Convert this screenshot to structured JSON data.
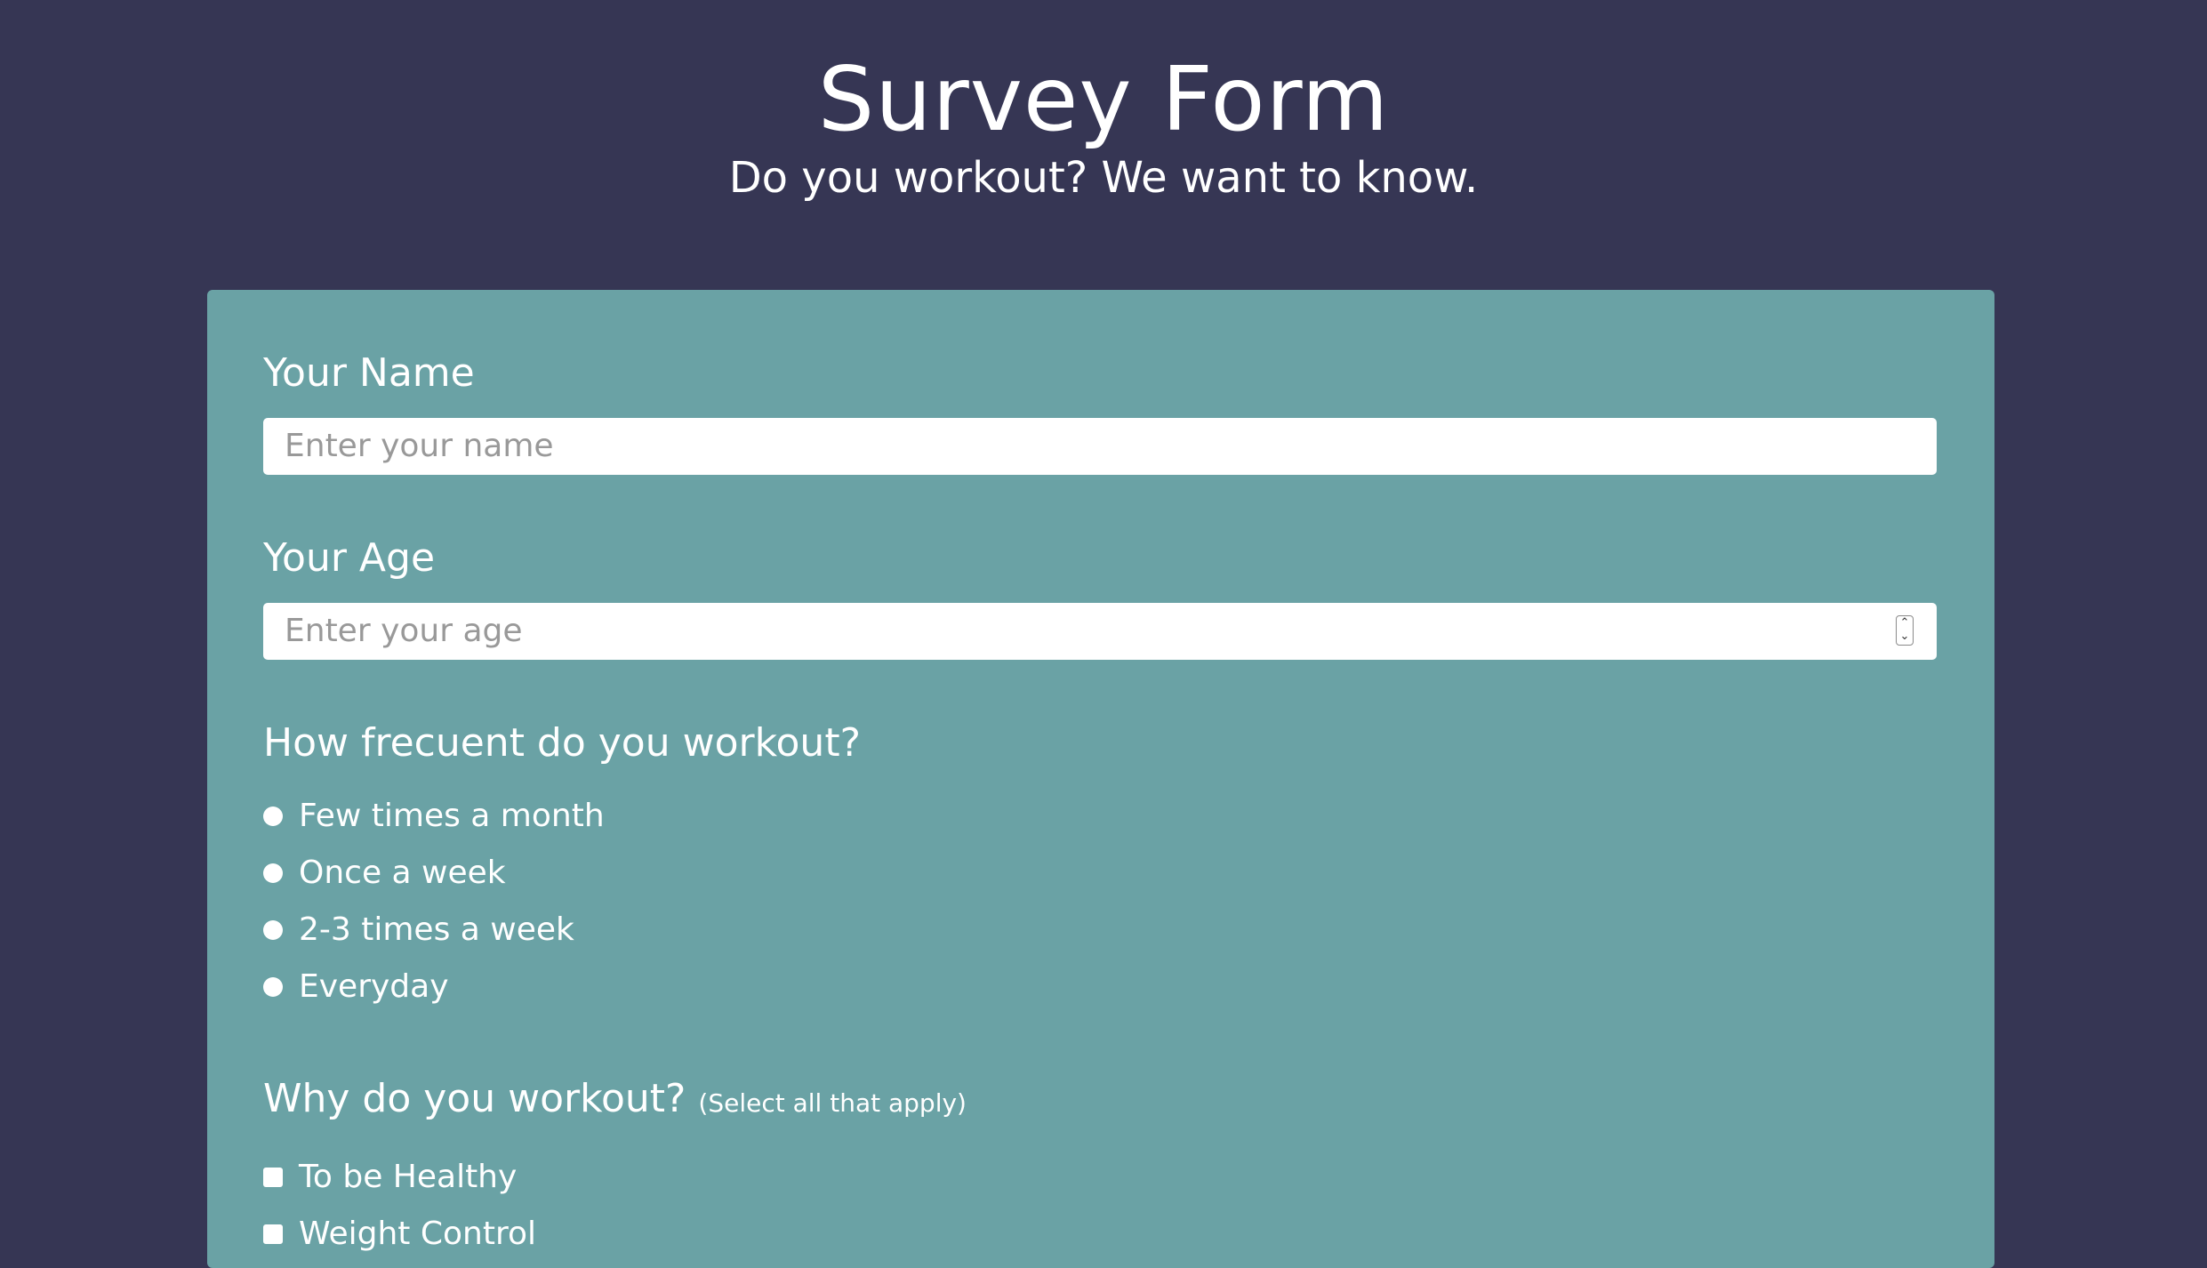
{
  "header": {
    "title": "Survey Form",
    "subtitle": "Do you workout? We want to know."
  },
  "form": {
    "name_field": {
      "label": "Your Name",
      "placeholder": "Enter your name"
    },
    "age_field": {
      "label": "Your Age",
      "placeholder": "Enter your age",
      "spinner_up": "⌃",
      "spinner_down": "⌄"
    },
    "frequency": {
      "question": "How frecuent do you workout?",
      "options": [
        "Few times a month",
        "Once a week",
        "2-3 times a week",
        "Everyday"
      ]
    },
    "reasons": {
      "question": "Why do you workout?",
      "hint": "(Select all that apply)",
      "options": [
        "To be Healthy",
        "Weight Control"
      ]
    }
  },
  "colors": {
    "page_background": "#363654",
    "card_background": "#6aa2a5",
    "input_background": "#ffffff",
    "placeholder_text": "#999999"
  }
}
